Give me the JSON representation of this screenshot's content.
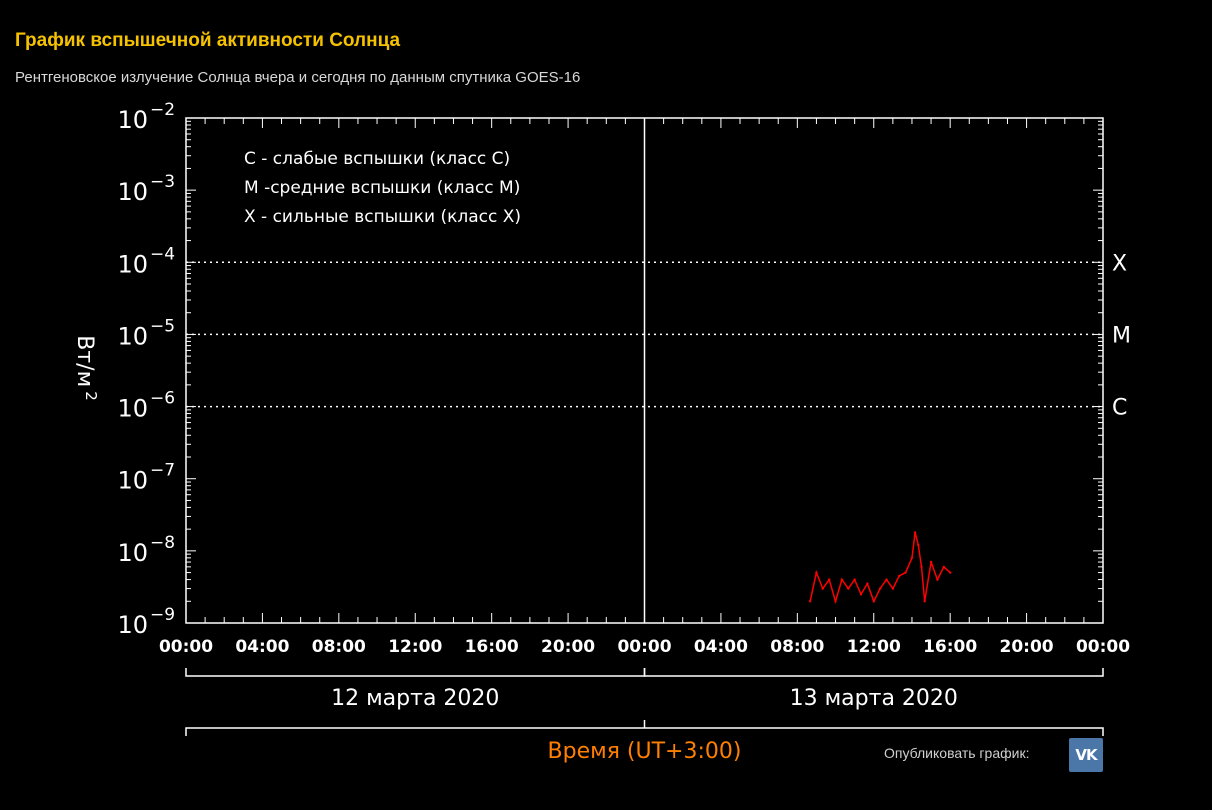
{
  "page": {
    "title": "График вспышечной активности Солнца",
    "subtitle": "Рентгеновское излучение Солнца вчера и сегодня по данным спутника GOES-16",
    "publish_label": "Опубликовать график:",
    "vk_label": "VK"
  },
  "colors": {
    "background": "#000000",
    "title": "#f5c200",
    "series": "#ff0000",
    "axis": "#ffffff",
    "xlabel": "#ff7f00",
    "vk": "#4a76a8"
  },
  "chart_data": {
    "type": "line",
    "y_scale": "log",
    "ylim": [
      1e-09,
      0.01
    ],
    "y_tick_exponents": [
      -2,
      -3,
      -4,
      -5,
      -6,
      -7,
      -8,
      -9
    ],
    "ylabel": "Вт/м 2",
    "xlim": [
      "2020-03-12 00:00",
      "2020-03-14 00:00"
    ],
    "x_tick_labels": [
      "00:00",
      "04:00",
      "08:00",
      "12:00",
      "16:00",
      "20:00",
      "00:00",
      "04:00",
      "08:00",
      "12:00",
      "16:00",
      "20:00",
      "00:00"
    ],
    "day_labels": [
      "12 марта 2020",
      "13 марта 2020"
    ],
    "xlabel": "Время (UT+3:00)",
    "legend": [
      "C - слабые вспышки (класс C)",
      "M -средние вспышки (класс M)",
      "X - сильные вспышки (класс X)"
    ],
    "class_levels": [
      {
        "label": "X",
        "value": 0.0001
      },
      {
        "label": "M",
        "value": 1e-05
      },
      {
        "label": "C",
        "value": 1e-06
      }
    ],
    "series": [
      {
        "x": [
          "2020-03-13 08:40",
          "2020-03-13 09:00",
          "2020-03-13 09:20",
          "2020-03-13 09:40",
          "2020-03-13 10:00",
          "2020-03-13 10:20",
          "2020-03-13 10:40",
          "2020-03-13 11:00",
          "2020-03-13 11:20",
          "2020-03-13 11:40",
          "2020-03-13 12:00",
          "2020-03-13 12:20",
          "2020-03-13 12:40",
          "2020-03-13 13:00",
          "2020-03-13 13:20",
          "2020-03-13 13:40",
          "2020-03-13 14:00",
          "2020-03-13 14:10",
          "2020-03-13 14:20",
          "2020-03-13 14:30",
          "2020-03-13 14:40",
          "2020-03-13 15:00",
          "2020-03-13 15:20",
          "2020-03-13 15:40",
          "2020-03-13 16:00"
        ],
        "y": [
          2e-09,
          5e-09,
          3e-09,
          4e-09,
          2e-09,
          4e-09,
          3e-09,
          4e-09,
          2.5e-09,
          3.5e-09,
          2e-09,
          3e-09,
          4e-09,
          3e-09,
          4.5e-09,
          5e-09,
          8e-09,
          1.8e-08,
          1.2e-08,
          6e-09,
          2e-09,
          7e-09,
          4e-09,
          6e-09,
          5e-09
        ]
      }
    ]
  }
}
